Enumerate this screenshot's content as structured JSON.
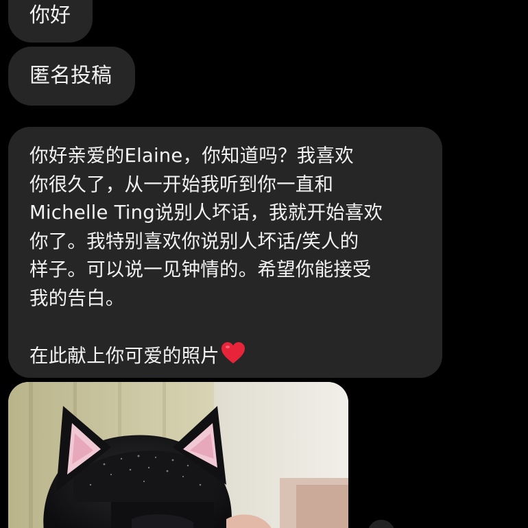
{
  "thread": {
    "messages": [
      {
        "text": "你好"
      },
      {
        "text": "匿名投稿"
      },
      {
        "lines": [
          "你好亲爱的Elaine，你知道吗？我喜欢",
          "你很久了，从一开始我听到你一直和",
          "Michelle Ting说别人坏话，我就开始喜欢",
          "你了。我特别喜欢你说别人坏话/笑人的",
          "样子。可以说一见钟情的。希望你能接受",
          "我的告白。",
          "",
          "在此献上你可爱的照片"
        ],
        "emoji": "red-heart-icon"
      }
    ],
    "photo": {
      "content": "photo-of-person-wearing-cat-ears"
    }
  },
  "colors": {
    "background": "#000000",
    "bubble": "#262626",
    "text": "#f2f2f2",
    "heart": "#e8243a"
  }
}
